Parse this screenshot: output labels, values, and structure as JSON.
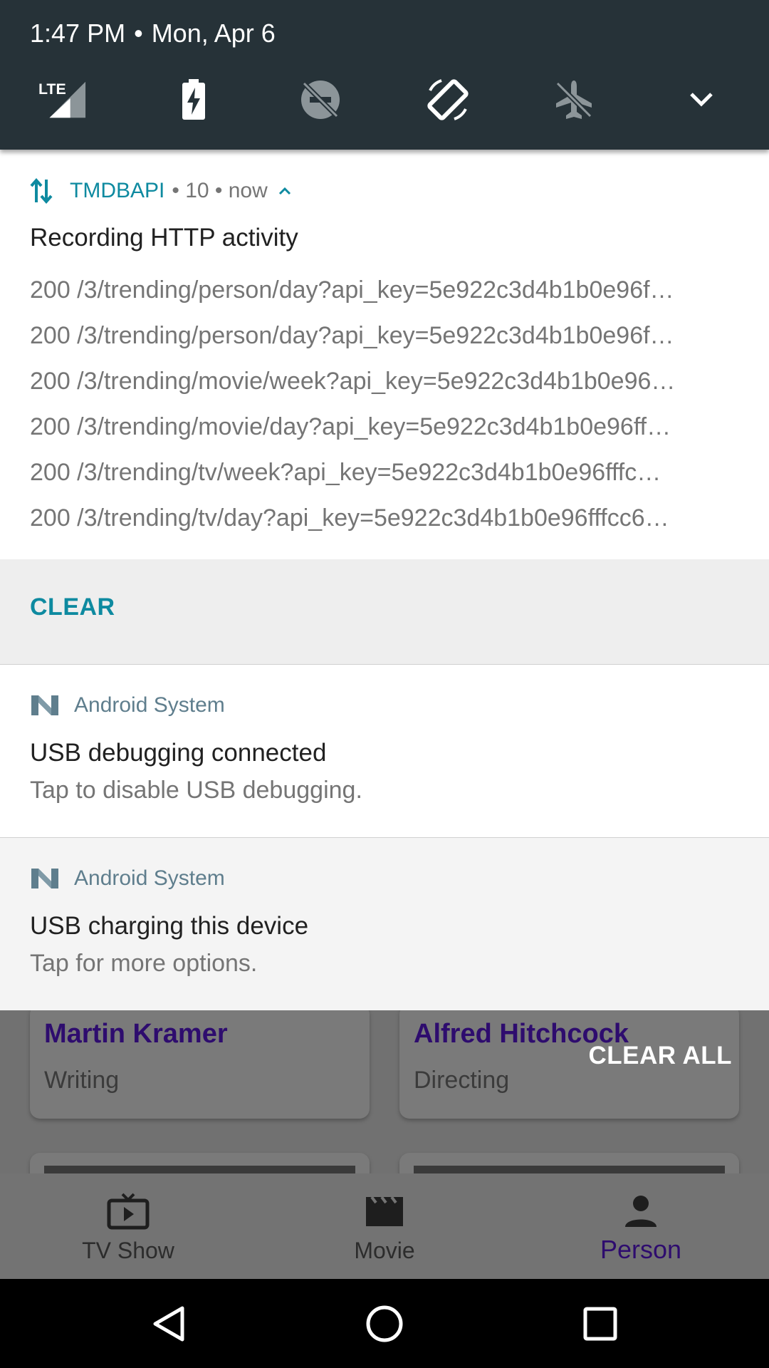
{
  "status": {
    "time": "1:47 PM",
    "separator": "•",
    "date": "Mon, Apr 6",
    "network_label": "LTE"
  },
  "quick_settings": {
    "icons": [
      "signal-lte-icon",
      "battery-charging-icon",
      "do-not-disturb-off-icon",
      "auto-rotate-icon",
      "airplane-mode-icon",
      "expand-chevron-icon"
    ]
  },
  "notifications": {
    "tmdb": {
      "app_name": "TMDBAPI",
      "meta": "• 10 • now",
      "title": "Recording HTTP activity",
      "lines": [
        "200 /3/trending/person/day?api_key=5e922c3d4b1b0e96f…",
        "200 /3/trending/person/day?api_key=5e922c3d4b1b0e96f…",
        "200 /3/trending/movie/week?api_key=5e922c3d4b1b0e96…",
        "200 /3/trending/movie/day?api_key=5e922c3d4b1b0e96ff…",
        "200 /3/trending/tv/week?api_key=5e922c3d4b1b0e96fffc…",
        "200 /3/trending/tv/day?api_key=5e922c3d4b1b0e96fffcc6…"
      ],
      "action_clear": "CLEAR"
    },
    "usb_debug": {
      "app_name": "Android System",
      "title": "USB debugging connected",
      "subtitle": "Tap to disable USB debugging."
    },
    "usb_charge": {
      "app_name": "Android System",
      "title": "USB charging this device",
      "subtitle": "Tap for more options."
    },
    "clear_all": "CLEAR ALL"
  },
  "app": {
    "cards": [
      {
        "name": "Martin Kramer",
        "role": "Writing"
      },
      {
        "name": "Alfred Hitchcock",
        "role": "Directing"
      }
    ],
    "bottom_nav": [
      {
        "label": "TV Show",
        "icon": "tv-icon"
      },
      {
        "label": "Movie",
        "icon": "movie-clapper-icon"
      },
      {
        "label": "Person",
        "icon": "person-icon"
      }
    ]
  },
  "colors": {
    "accent": "#0e8aa0",
    "header_bg": "#263238",
    "active_nav": "#2e0c6e"
  }
}
